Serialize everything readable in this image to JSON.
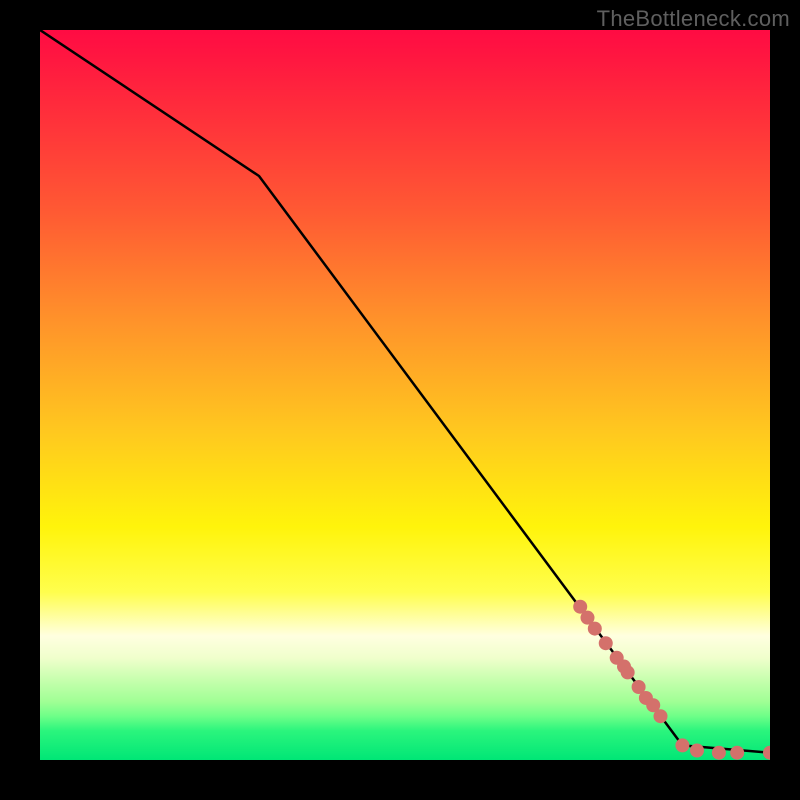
{
  "watermark": "TheBottleneck.com",
  "chart_data": {
    "type": "line",
    "title": "",
    "xlabel": "",
    "ylabel": "",
    "xlim": [
      0,
      100
    ],
    "ylim": [
      0,
      100
    ],
    "line": {
      "points": [
        {
          "x": 0,
          "y": 100
        },
        {
          "x": 30,
          "y": 80
        },
        {
          "x": 88,
          "y": 2
        },
        {
          "x": 100,
          "y": 1
        }
      ],
      "color": "#000000"
    },
    "scatter": {
      "color": "#d4716b",
      "radius": 7,
      "points": [
        {
          "x": 74.0,
          "y": 21.0
        },
        {
          "x": 75.0,
          "y": 19.5
        },
        {
          "x": 76.0,
          "y": 18.0
        },
        {
          "x": 77.5,
          "y": 16.0
        },
        {
          "x": 79.0,
          "y": 14.0
        },
        {
          "x": 80.0,
          "y": 12.8
        },
        {
          "x": 80.5,
          "y": 12.0
        },
        {
          "x": 82.0,
          "y": 10.0
        },
        {
          "x": 83.0,
          "y": 8.5
        },
        {
          "x": 84.0,
          "y": 7.5
        },
        {
          "x": 85.0,
          "y": 6.0
        },
        {
          "x": 88.0,
          "y": 2.0
        },
        {
          "x": 90.0,
          "y": 1.3
        },
        {
          "x": 93.0,
          "y": 1.0
        },
        {
          "x": 95.5,
          "y": 1.0
        },
        {
          "x": 100.0,
          "y": 1.0
        }
      ]
    }
  }
}
